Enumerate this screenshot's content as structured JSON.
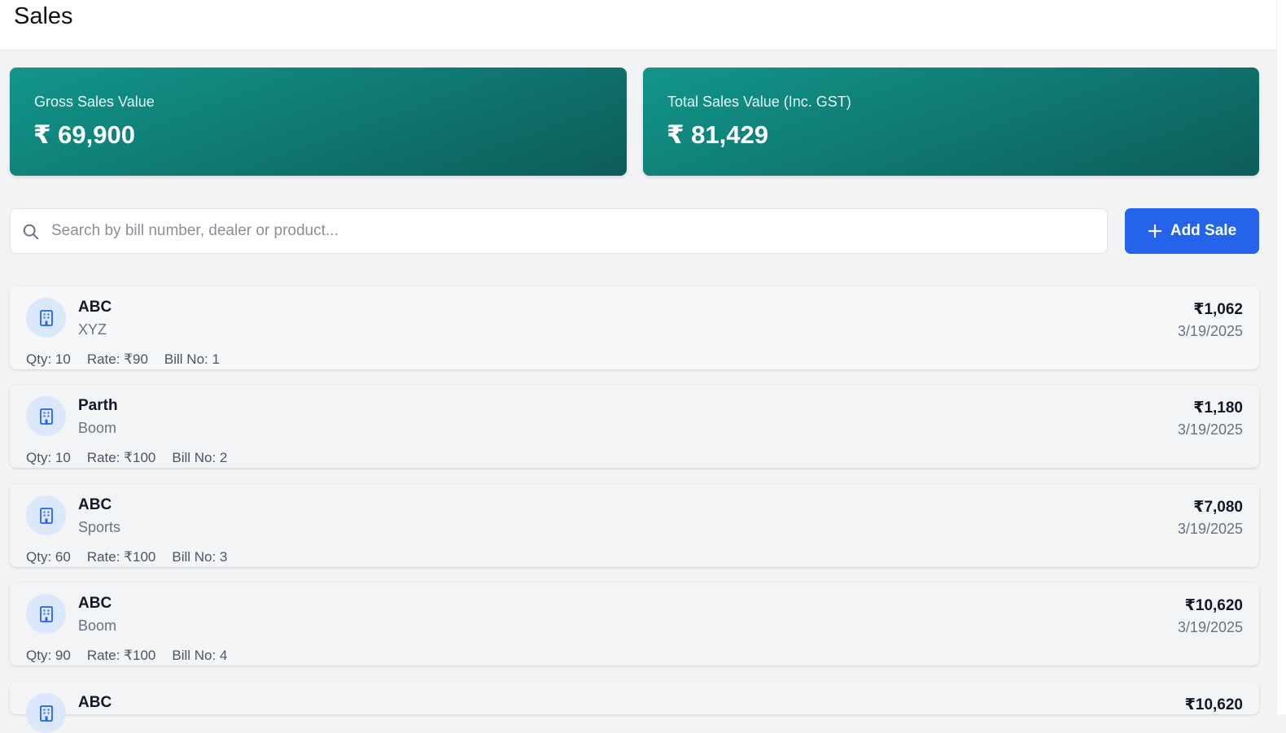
{
  "header": {
    "title": "Sales"
  },
  "stats": {
    "gross_label": "Gross Sales Value",
    "gross_value": "₹ 69,900",
    "total_label": "Total Sales Value (Inc. GST)",
    "total_value": "₹ 81,429"
  },
  "search": {
    "placeholder": "Search by bill number, dealer or product...",
    "value": ""
  },
  "actions": {
    "add_sale_label": "Add Sale"
  },
  "colors": {
    "accent": "#2563eb",
    "card_teal": "#0f7670",
    "avatar_bg": "#dbe7fb"
  },
  "icons": {
    "search": "search-icon",
    "add": "plus-icon",
    "dealer": "building-icon"
  },
  "sales": [
    {
      "dealer": "ABC",
      "product": "XYZ",
      "amount": "₹1,062",
      "date": "3/19/2025",
      "qty": "Qty: 10",
      "rate": "Rate: ₹90",
      "bill": "Bill No: 1"
    },
    {
      "dealer": "Parth",
      "product": "Boom",
      "amount": "₹1,180",
      "date": "3/19/2025",
      "qty": "Qty: 10",
      "rate": "Rate: ₹100",
      "bill": "Bill No: 2"
    },
    {
      "dealer": "ABC",
      "product": "Sports",
      "amount": "₹7,080",
      "date": "3/19/2025",
      "qty": "Qty: 60",
      "rate": "Rate: ₹100",
      "bill": "Bill No: 3"
    },
    {
      "dealer": "ABC",
      "product": "Boom",
      "amount": "₹10,620",
      "date": "3/19/2025",
      "qty": "Qty: 90",
      "rate": "Rate: ₹100",
      "bill": "Bill No: 4"
    },
    {
      "dealer": "ABC",
      "product": "",
      "amount": "₹10,620",
      "date": "",
      "qty": "",
      "rate": "",
      "bill": ""
    }
  ]
}
